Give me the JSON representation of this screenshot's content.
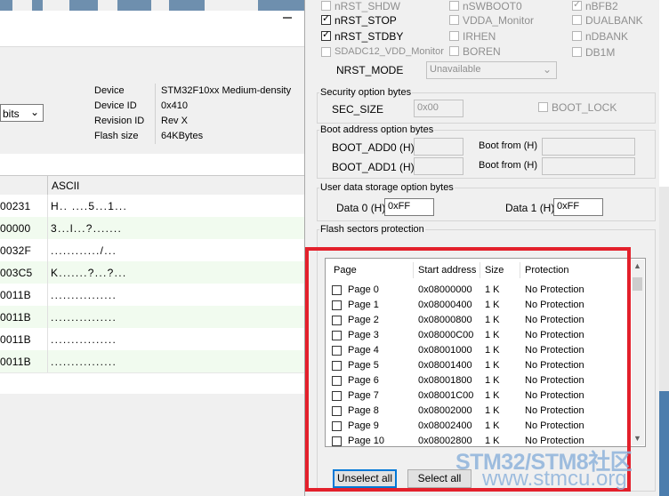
{
  "background_window": {
    "bits_select": "bits",
    "device_info": [
      {
        "key": "Device",
        "value": "STM32F10xx Medium-density"
      },
      {
        "key": "Device ID",
        "value": "0x410"
      },
      {
        "key": "Revision ID",
        "value": "Rev X"
      },
      {
        "key": "Flash size",
        "value": "64KBytes"
      }
    ],
    "memory_table": {
      "ascii_header": "ASCII",
      "rows": [
        {
          "hex": "00231",
          "ascii": "H.. ....5...1..."
        },
        {
          "hex": "00000",
          "ascii": "3...l...?......."
        },
        {
          "hex": "0032F",
          "ascii": "............/..."
        },
        {
          "hex": "003C5",
          "ascii": "K.......?...?..."
        },
        {
          "hex": "0011B",
          "ascii": "................"
        },
        {
          "hex": "0011B",
          "ascii": "................"
        },
        {
          "hex": "0011B",
          "ascii": "................"
        },
        {
          "hex": "0011B",
          "ascii": "................"
        }
      ]
    }
  },
  "user_config": {
    "col1": [
      {
        "label": "nRST_SHDW",
        "checked": false,
        "disabled": true
      },
      {
        "label": "nRST_STOP",
        "checked": true,
        "disabled": false
      },
      {
        "label": "nRST_STDBY",
        "checked": true,
        "disabled": false
      },
      {
        "label": "SDADC12_VDD_Monitor",
        "checked": false,
        "disabled": true
      }
    ],
    "col2": [
      {
        "label": "nSWBOOT0",
        "checked": false,
        "disabled": true
      },
      {
        "label": "VDDA_Monitor",
        "checked": false,
        "disabled": true
      },
      {
        "label": "IRHEN",
        "checked": false,
        "disabled": true
      },
      {
        "label": "BOREN",
        "checked": false,
        "disabled": true
      }
    ],
    "col3": [
      {
        "label": "nBFB2",
        "checked": true,
        "disabled": true
      },
      {
        "label": "DUALBANK",
        "checked": false,
        "disabled": true
      },
      {
        "label": "nDBANK",
        "checked": false,
        "disabled": true
      },
      {
        "label": "DB1M",
        "checked": false,
        "disabled": true
      }
    ],
    "nrst_mode_label": "NRST_MODE",
    "nrst_mode_value": "Unavailable"
  },
  "security": {
    "title": "Security option bytes",
    "sec_size_label": "SEC_SIZE",
    "sec_size_value": "0x00",
    "boot_lock_label": "BOOT_LOCK"
  },
  "boot_address": {
    "title": "Boot address option bytes",
    "add0_label": "BOOT_ADD0 (H)",
    "add1_label": "BOOT_ADD1 (H)",
    "boot_from_label": "Boot from (H)"
  },
  "user_data": {
    "title": "User data storage option bytes",
    "data0_label": "Data 0 (H)",
    "data0_value": "0xFF",
    "data1_label": "Data 1 (H)",
    "data1_value": "0xFF"
  },
  "flash": {
    "title": "Flash sectors protection",
    "headers": {
      "page": "Page",
      "start": "Start address",
      "size": "Size",
      "protection": "Protection"
    },
    "rows": [
      {
        "page": "Page 0",
        "address": "0x08000000",
        "size": "1 K",
        "protection": "No Protection"
      },
      {
        "page": "Page 1",
        "address": "0x08000400",
        "size": "1 K",
        "protection": "No Protection"
      },
      {
        "page": "Page 2",
        "address": "0x08000800",
        "size": "1 K",
        "protection": "No Protection"
      },
      {
        "page": "Page 3",
        "address": "0x08000C00",
        "size": "1 K",
        "protection": "No Protection"
      },
      {
        "page": "Page 4",
        "address": "0x08001000",
        "size": "1 K",
        "protection": "No Protection"
      },
      {
        "page": "Page 5",
        "address": "0x08001400",
        "size": "1 K",
        "protection": "No Protection"
      },
      {
        "page": "Page 6",
        "address": "0x08001800",
        "size": "1 K",
        "protection": "No Protection"
      },
      {
        "page": "Page 7",
        "address": "0x08001C00",
        "size": "1 K",
        "protection": "No Protection"
      },
      {
        "page": "Page 8",
        "address": "0x08002000",
        "size": "1 K",
        "protection": "No Protection"
      },
      {
        "page": "Page 9",
        "address": "0x08002400",
        "size": "1 K",
        "protection": "No Protection"
      },
      {
        "page": "Page 10",
        "address": "0x08002800",
        "size": "1 K",
        "protection": "No Protection"
      }
    ],
    "unselect_all": "Unselect all",
    "select_all": "Select all"
  },
  "watermark": {
    "line1": "STM32/STM8社区",
    "line2": "www.stmcu.org"
  },
  "colors": {
    "highlight_box": "#e3202b",
    "watermark": "#8fb4dc",
    "default_button_border": "#0078d7"
  }
}
